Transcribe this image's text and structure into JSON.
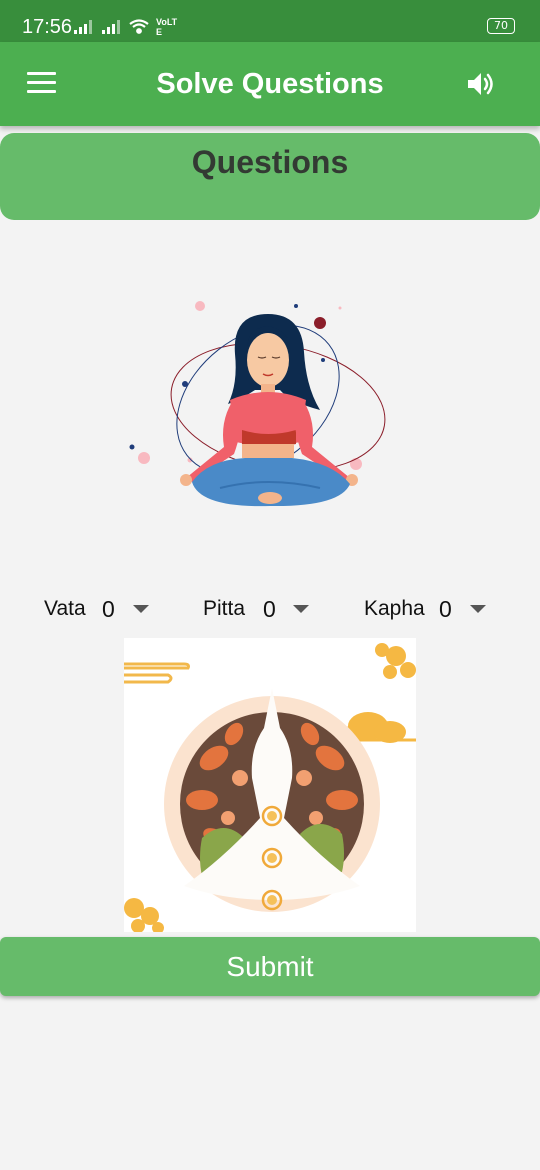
{
  "status_bar": {
    "time": "17:56",
    "network_label": "VoLTE",
    "battery": "70"
  },
  "app_bar": {
    "title": "Solve Questions",
    "menu_icon": "hamburger-menu-icon",
    "volume_icon": "volume-icon"
  },
  "section": {
    "title": "Questions"
  },
  "doshas": [
    {
      "label": "Vata",
      "value": "0"
    },
    {
      "label": "Pitta",
      "value": "0"
    },
    {
      "label": "Kapha",
      "value": "0"
    }
  ],
  "submit": {
    "label": "Submit"
  },
  "colors": {
    "status_bar": "#388e3c",
    "app_bar": "#4caf50",
    "accent_green": "#66bb6a",
    "background": "#f3f3f3"
  }
}
